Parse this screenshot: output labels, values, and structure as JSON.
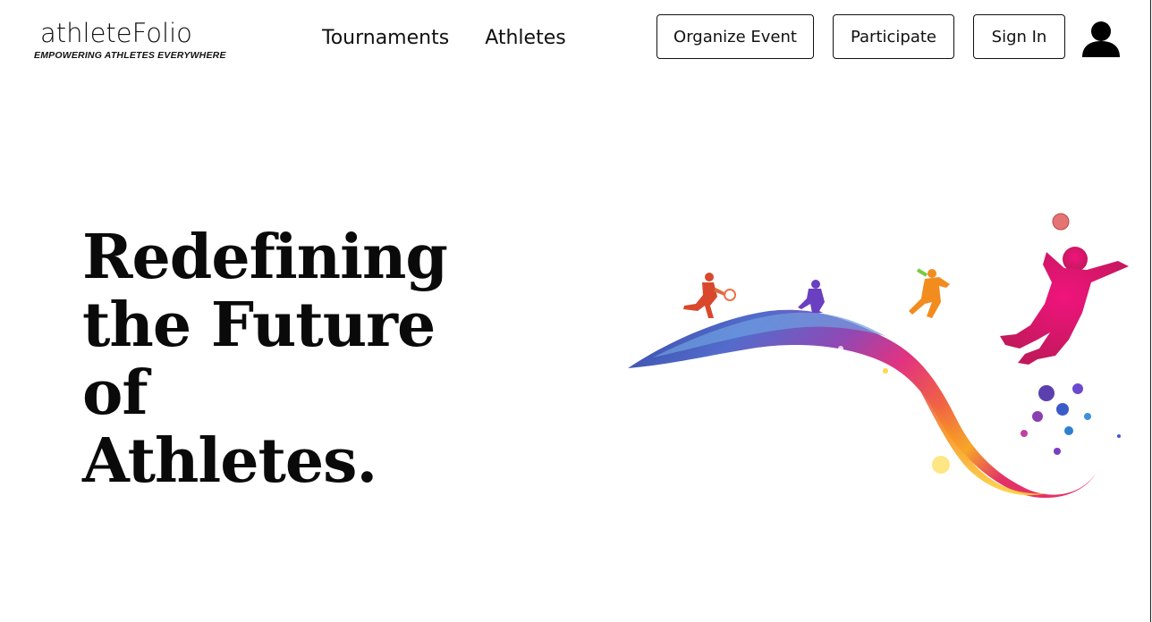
{
  "brand": {
    "name": "athleteFolio",
    "tagline": "EMPOWERING ATHLETES EVERYWHERE"
  },
  "nav": {
    "items": [
      {
        "label": "Tournaments"
      },
      {
        "label": "Athletes"
      }
    ]
  },
  "actions": {
    "organize_label": "Organize Event",
    "participate_label": "Participate",
    "signin_label": "Sign In"
  },
  "hero": {
    "title_lines": [
      "Redefining",
      "the Future",
      "of",
      "Athletes."
    ]
  },
  "icons": {
    "avatar": "user-icon"
  },
  "colors": {
    "text": "#111111",
    "background": "#ffffff",
    "art_magenta": "#e6007e",
    "art_blue": "#3d3fa8",
    "art_orange": "#f28c1e"
  }
}
